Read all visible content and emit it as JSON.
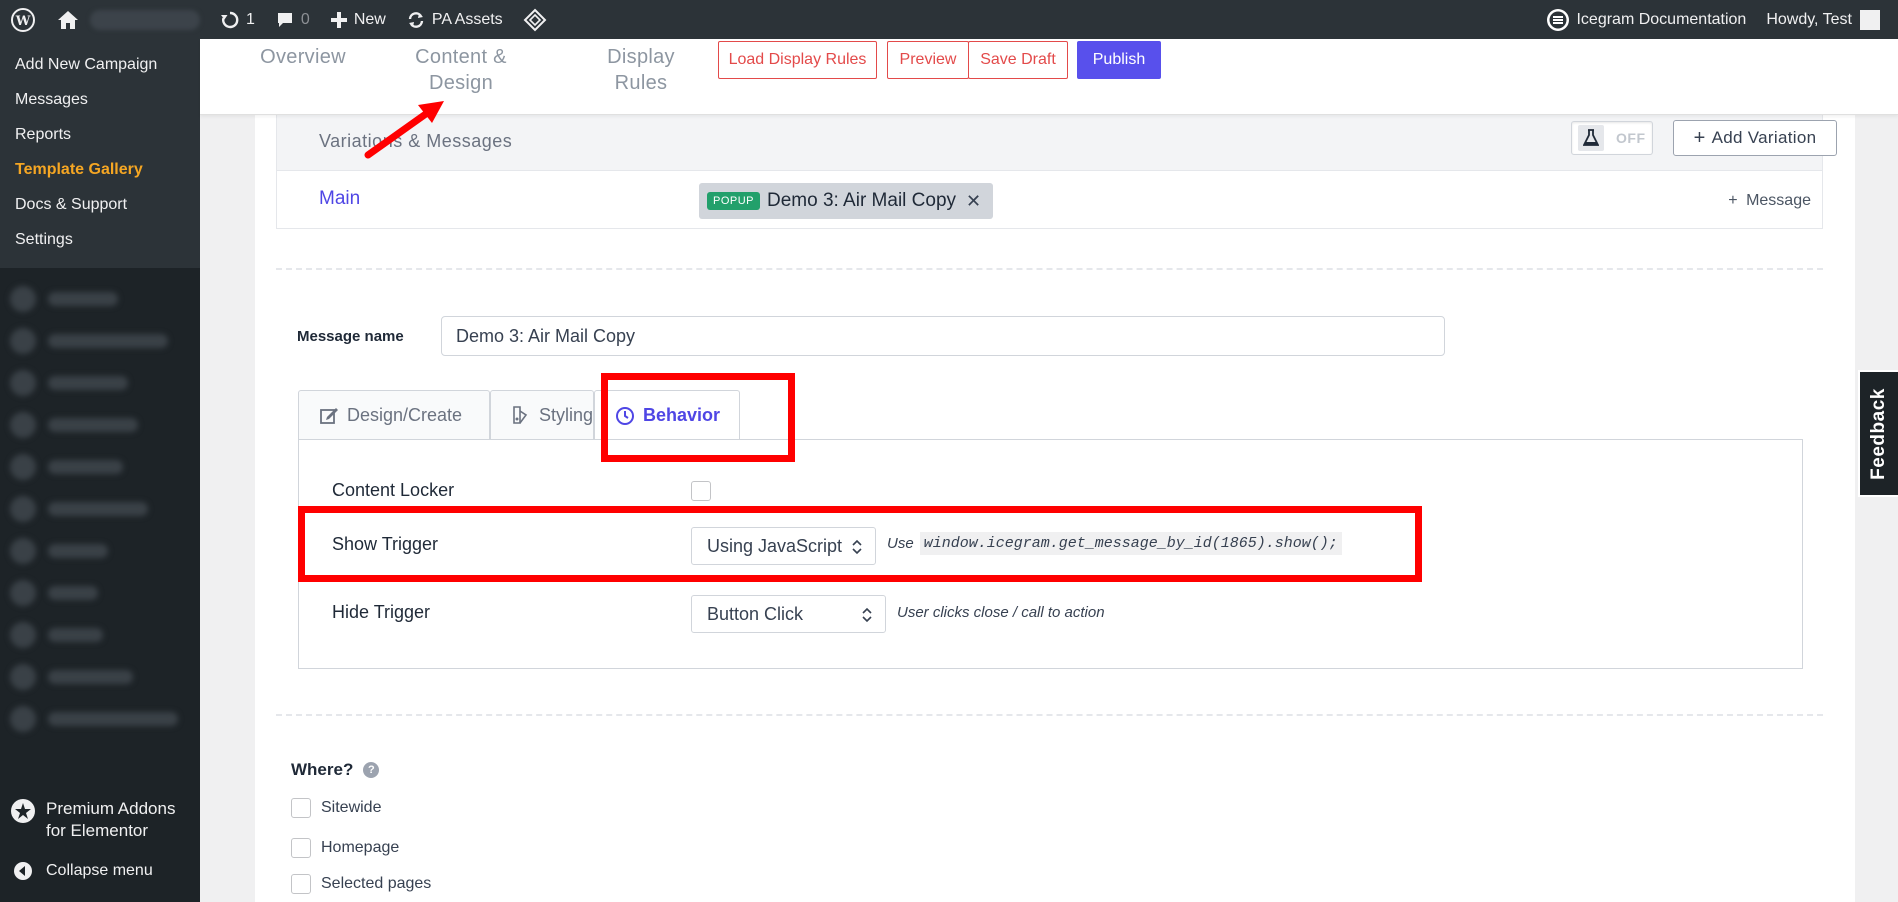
{
  "adminbar": {
    "updates_count": "1",
    "comments_count": "0",
    "new_label": "New",
    "pa_assets_label": "PA Assets",
    "documentation_label": "Icegram Documentation",
    "howdy_label": "Howdy, Test"
  },
  "sidebar": {
    "items": [
      {
        "label": "Add New Campaign"
      },
      {
        "label": "Messages"
      },
      {
        "label": "Reports"
      },
      {
        "label": "Template Gallery"
      },
      {
        "label": "Docs & Support"
      },
      {
        "label": "Settings"
      }
    ],
    "current_index": 3,
    "premium_addons_label": "Premium Addons for Elementor",
    "collapse_label": "Collapse menu"
  },
  "toppanel": {
    "tabs": [
      {
        "label": "Overview"
      },
      {
        "label": "Content & Design"
      },
      {
        "label": "Display Rules"
      }
    ],
    "load_display_rules": "Load Display Rules",
    "preview": "Preview",
    "save_draft": "Save Draft",
    "publish": "Publish"
  },
  "variations": {
    "title": "Variations & Messages",
    "toggle_label": "OFF",
    "add_variation": "Add Variation",
    "main_label": "Main",
    "message_type": "POPUP",
    "message_name": "Demo 3: Air Mail Copy",
    "add_message": "Message"
  },
  "message_form": {
    "name_label": "Message name",
    "name_value": "Demo 3: Air Mail Copy",
    "tabs": [
      {
        "label": "Design/Create"
      },
      {
        "label": "Styling"
      },
      {
        "label": "Behavior"
      }
    ],
    "active_tab": 2,
    "content_locker_label": "Content Locker",
    "show_trigger_label": "Show Trigger",
    "show_trigger_value": "Using JavaScript",
    "show_trigger_hint": "Use",
    "show_trigger_code": "window.icegram.get_message_by_id(1865).show();",
    "hide_trigger_label": "Hide Trigger",
    "hide_trigger_value": "Button Click",
    "hide_trigger_hint": "User clicks close / call to action"
  },
  "where": {
    "title": "Where?",
    "options": [
      {
        "label": "Sitewide"
      },
      {
        "label": "Homepage"
      },
      {
        "label": "Selected pages"
      }
    ]
  },
  "feedback_label": "Feedback",
  "colors": {
    "accent": "#5850ec",
    "annotation": "#ff0000",
    "menu_current": "#f5a623",
    "popup_badge": "#22a06b"
  }
}
